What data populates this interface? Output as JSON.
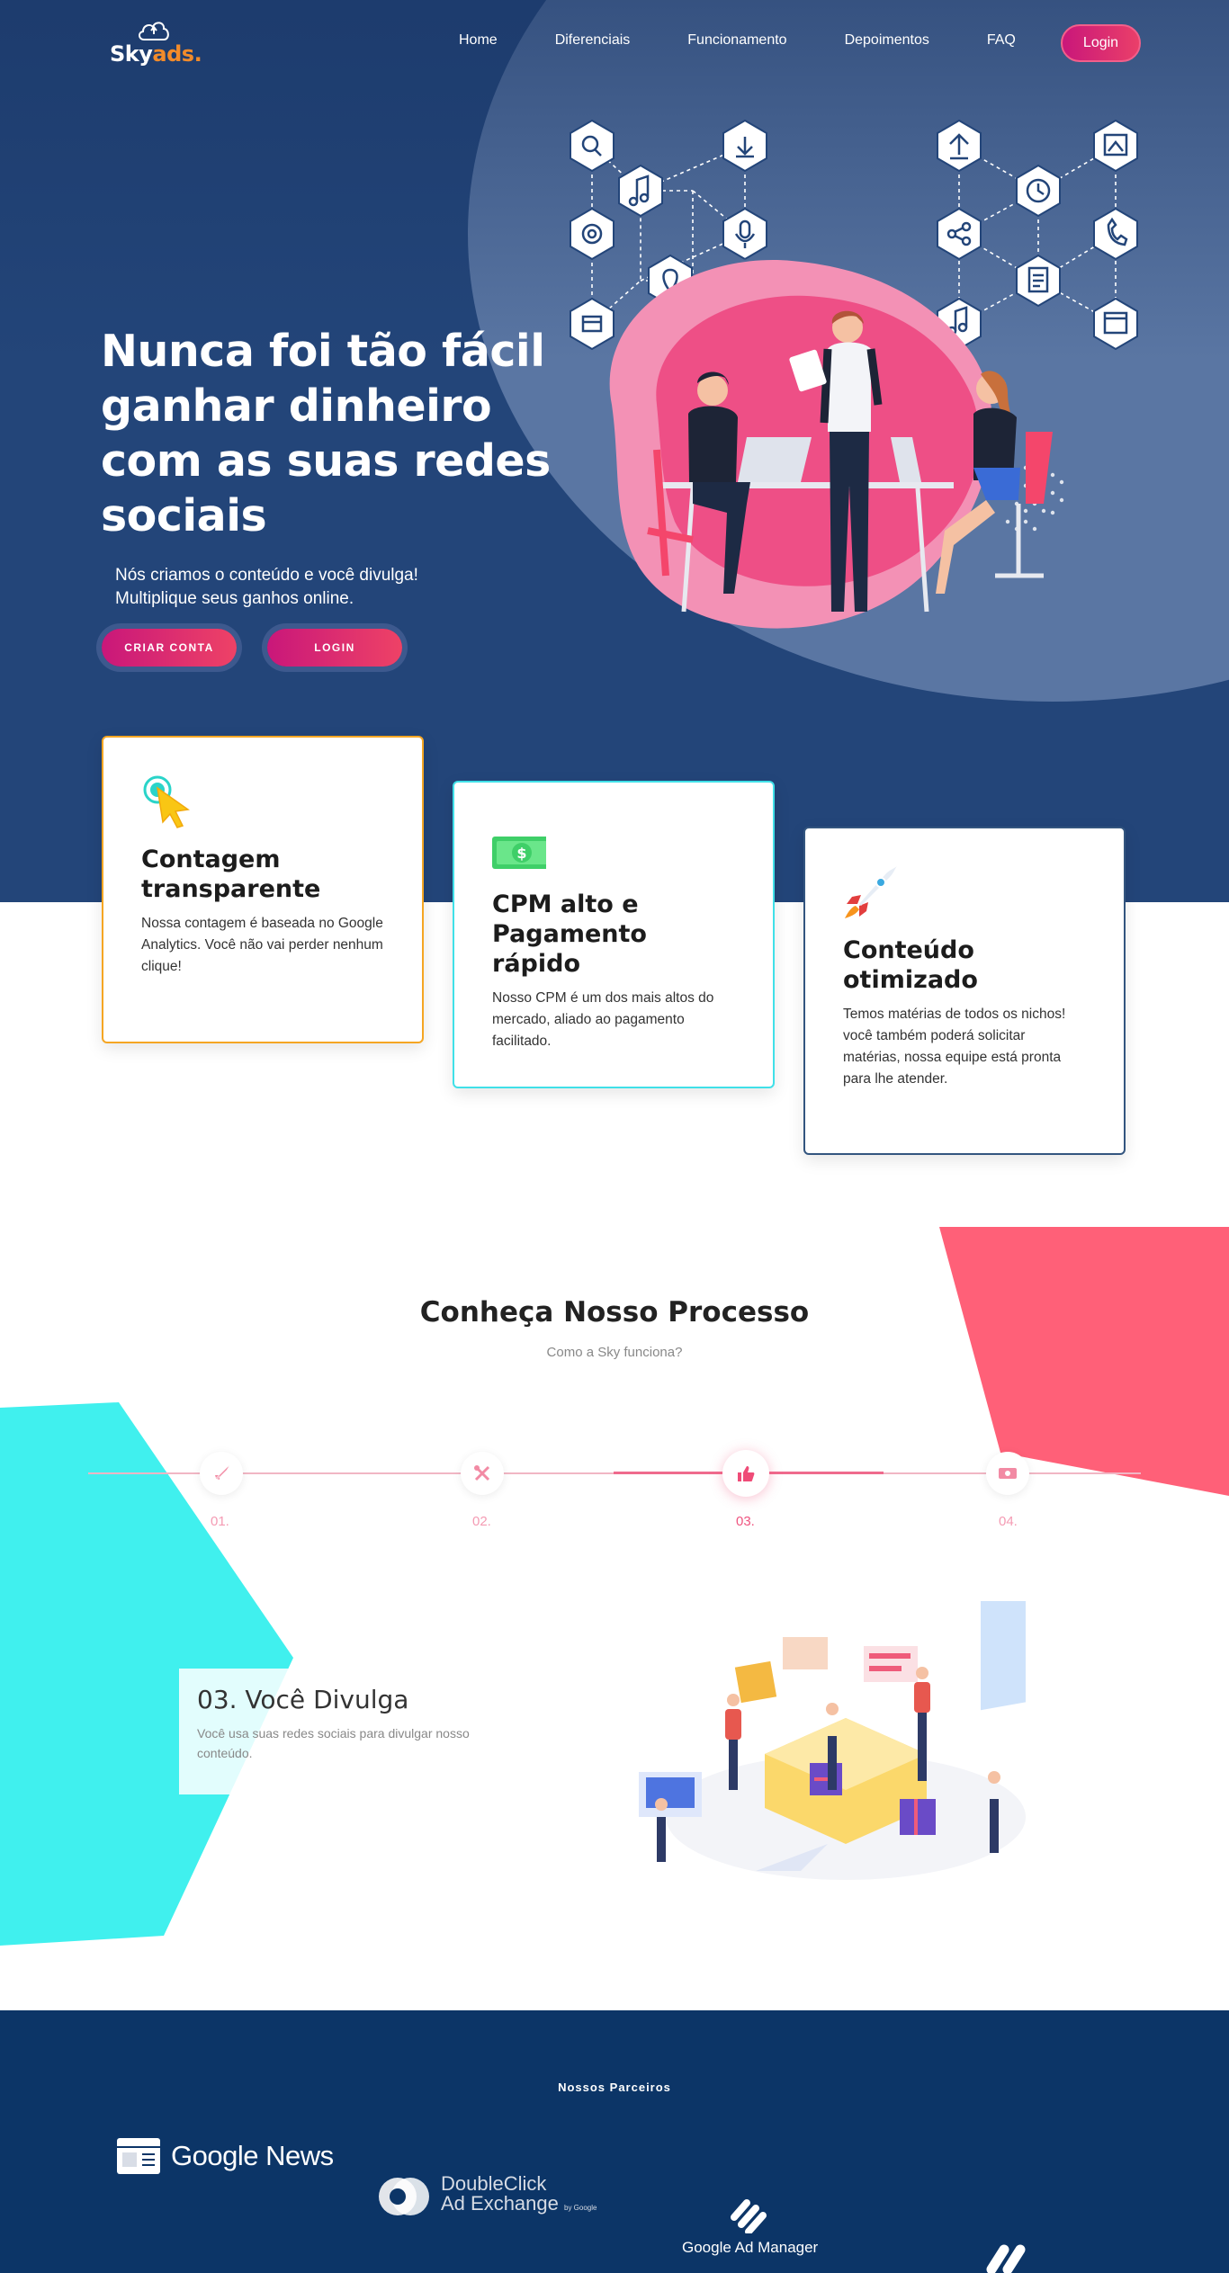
{
  "brand": {
    "logo_main": "Sky",
    "logo_accent": "ads",
    "logo_dot": ".",
    "accent_color": "#f28b2a"
  },
  "nav": {
    "links": [
      "Home",
      "Diferenciais",
      "Funcionamento",
      "Depoimentos",
      "FAQ"
    ],
    "login": "Login"
  },
  "hero": {
    "title": "Nunca foi tão fácil ganhar dinheiro com as suas redes sociais",
    "subtitle_line1": "Nós criamos o conteúdo e você divulga!",
    "subtitle_line2": "Multiplique seus ganhos online.",
    "btn_create": "CRIAR CONTA",
    "btn_login": "LOGIN"
  },
  "features": [
    {
      "icon": "click-cursor-icon",
      "title": "Contagem transparente",
      "text": "Nossa contagem é baseada no Google Analytics. Você não vai perder nenhum clique!",
      "border_color": "#f5a623"
    },
    {
      "icon": "money-bill-icon",
      "title": "CPM alto e Pagamento rápido",
      "text": "Nosso CPM é um dos mais altos do mercado, aliado ao pagamento facilitado.",
      "border_color": "#40e0e8"
    },
    {
      "icon": "rocket-icon",
      "title": "Conteúdo otimizado",
      "text": "Temos matérias de todos os nichos! você também poderá solicitar matérias, nossa equipe está pronta para lhe atender.",
      "border_color": "#33557f"
    }
  ],
  "process": {
    "title": "Conheça Nosso Processo",
    "subtitle": "Como a Sky funciona?",
    "steps": [
      {
        "label": "01.",
        "icon": "rocket-icon"
      },
      {
        "label": "02.",
        "icon": "tools-icon"
      },
      {
        "label": "03.",
        "icon": "thumbs-up-icon"
      },
      {
        "label": "04.",
        "icon": "money-icon"
      }
    ],
    "active_step": 3,
    "current_title": "03. Você Divulga",
    "current_text": "Você usa suas redes sociais para divulgar nosso conteúdo."
  },
  "partners": {
    "title": "Nossos Parceiros",
    "google_news": "Google News",
    "doubleclick_line1": "DoubleClick",
    "doubleclick_line2": "Ad Exchange",
    "doubleclick_small": "by Google",
    "ad_manager": "Google Ad Manager"
  },
  "colors": {
    "hero_bg": "#234579",
    "pink": "#ef5580",
    "cyan": "#40f0ee",
    "partners_bg": "#0c3567"
  }
}
